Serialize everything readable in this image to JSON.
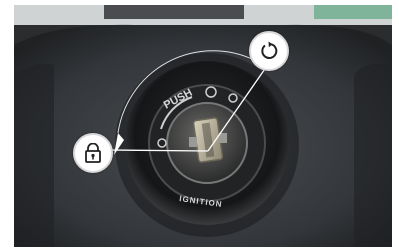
{
  "photo": {
    "description_labels": {
      "push_text": "PUSH",
      "ignition_text": "IGNITION"
    }
  },
  "callouts": [
    {
      "icon": "lock-icon"
    },
    {
      "icon": "rotate-icon"
    }
  ],
  "colors": {
    "background_dark": "#2a2c2e",
    "panel": "#3a3d40",
    "bezel": "#1e1f21",
    "key_metal": "#b9b39e",
    "callout_fill": "#ffffff",
    "callout_line": "#ffffff"
  }
}
